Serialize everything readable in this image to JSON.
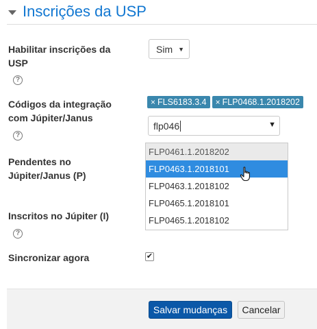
{
  "section": {
    "title": "Inscrições da USP"
  },
  "fields": {
    "enable": {
      "label_line1": "Habilitar inscrições da",
      "label_line2": "USP",
      "value": "Sim",
      "help": "?"
    },
    "codes": {
      "label_line1": "Códigos da integração",
      "label_line2": "com Júpiter/Janus",
      "help": "?",
      "tags": [
        "FLS6183.3.4",
        "FLP0468.1.2018202"
      ],
      "tag_remove": "×",
      "search_value": "flp046"
    },
    "pending": {
      "label_line1": "Pendentes no",
      "label_line2": "Júpiter/Janus (P)"
    },
    "enrolled": {
      "label": "Inscritos no Júpiter (I)",
      "help": "?"
    },
    "sync": {
      "label": "Sincronizar agora",
      "checked": true
    }
  },
  "dropdown": {
    "options": [
      "FLP0461.1.2018202",
      "FLP0463.1.2018101",
      "FLP0463.1.2018102",
      "FLP0465.1.2018101",
      "FLP0465.1.2018102"
    ],
    "highlighted_index": 1
  },
  "buttons": {
    "save": "Salvar mudanças",
    "cancel": "Cancelar"
  },
  "colors": {
    "title": "#1177d1",
    "tag": "#3a87ad",
    "highlight": "#2f8ce0",
    "primary_button": "#0b58a8"
  }
}
